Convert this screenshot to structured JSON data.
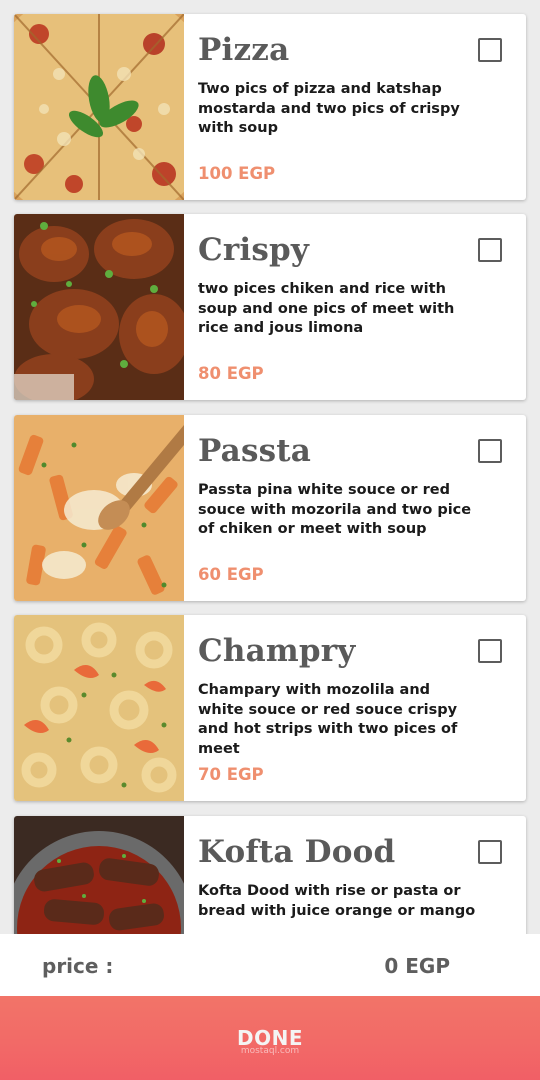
{
  "items": [
    {
      "title": "Pizza",
      "description": "Two pics of pizza and katshap mostarda and two pics of crispy with soup",
      "price": "100 EGP",
      "image_alt": "pizza photo",
      "checked": false
    },
    {
      "title": "Crispy",
      "description": "two pices chiken and rice with soup and one pics of meet with rice and jous limona",
      "price": "80 EGP",
      "image_alt": "crispy chicken photo",
      "checked": false
    },
    {
      "title": "Passta",
      "description": "Passta pina white souce or red souce with mozorila and two pice of chiken or meet with soup",
      "price": "60 EGP",
      "image_alt": "pasta photo",
      "checked": false
    },
    {
      "title": "Champry",
      "description": "Champary with mozolila and white souce or red souce crispy and hot strips with two pices of meet",
      "price": "70 EGP",
      "image_alt": "shrimp pasta photo",
      "checked": false
    },
    {
      "title": "Kofta Dood",
      "description": "Kofta Dood with rise or pasta or bread with juice orange or mango",
      "price": "",
      "image_alt": "kofta photo",
      "checked": false
    }
  ],
  "footer": {
    "price_label": "price :",
    "price_value": "0 EGP"
  },
  "done_button": {
    "label": "DONE",
    "watermark": "mostaql.com"
  },
  "colors": {
    "price": "#ef8f6f",
    "done_background": "#f26a67",
    "title": "#5a5a5a"
  }
}
